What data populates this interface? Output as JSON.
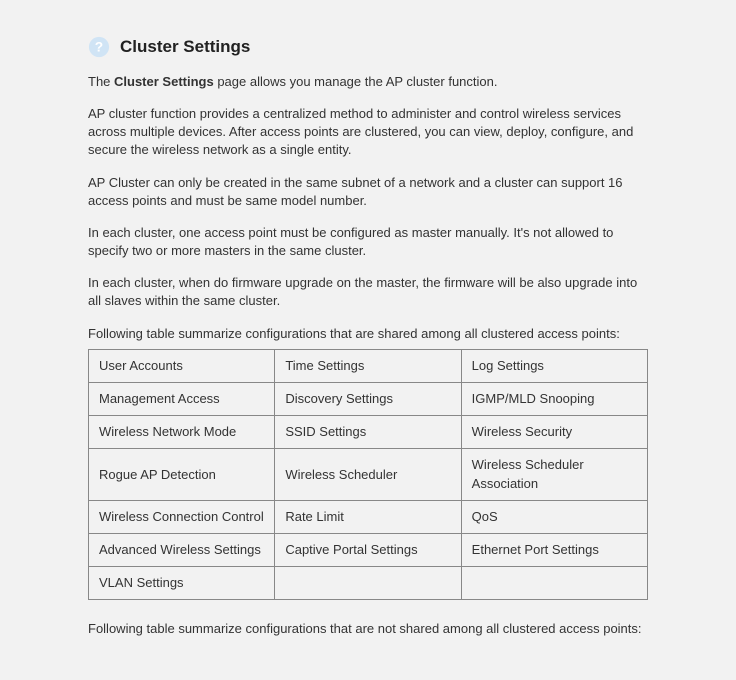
{
  "header": {
    "title": "Cluster Settings"
  },
  "intro": {
    "p1_prefix": "The ",
    "p1_bold": "Cluster Settings",
    "p1_suffix": " page allows you manage the AP cluster function.",
    "p2": "AP cluster function provides a centralized method to administer and control wireless services across multiple devices. After access points are clustered, you can view, deploy, configure, and secure the wireless network as a single entity.",
    "p3": "AP Cluster can only be created in the same subnet of a network and a cluster can support 16 access points and must be same model number.",
    "p4": "In each cluster, one access point must be configured as master manually. It's not allowed to specify two or more masters in the same cluster.",
    "p5": "In each cluster, when do firmware upgrade on the master, the firmware will be also upgrade into all slaves within the same cluster.",
    "shared_caption": "Following table summarize configurations that are shared among all clustered access points:",
    "not_shared_caption": "Following table summarize configurations that are not shared among all clustered access points:"
  },
  "shared_table": {
    "rows": [
      [
        "User Accounts",
        "Time Settings",
        "Log Settings"
      ],
      [
        "Management Access",
        "Discovery Settings",
        "IGMP/MLD Snooping"
      ],
      [
        "Wireless Network Mode",
        "SSID Settings",
        "Wireless Security"
      ],
      [
        "Rogue AP Detection",
        "Wireless Scheduler",
        "Wireless Scheduler Association"
      ],
      [
        "Wireless Connection Control",
        "Rate Limit",
        "QoS"
      ],
      [
        "Advanced Wireless Settings",
        "Captive Portal Settings",
        "Ethernet Port Settings"
      ],
      [
        "VLAN Settings",
        "",
        ""
      ]
    ]
  }
}
